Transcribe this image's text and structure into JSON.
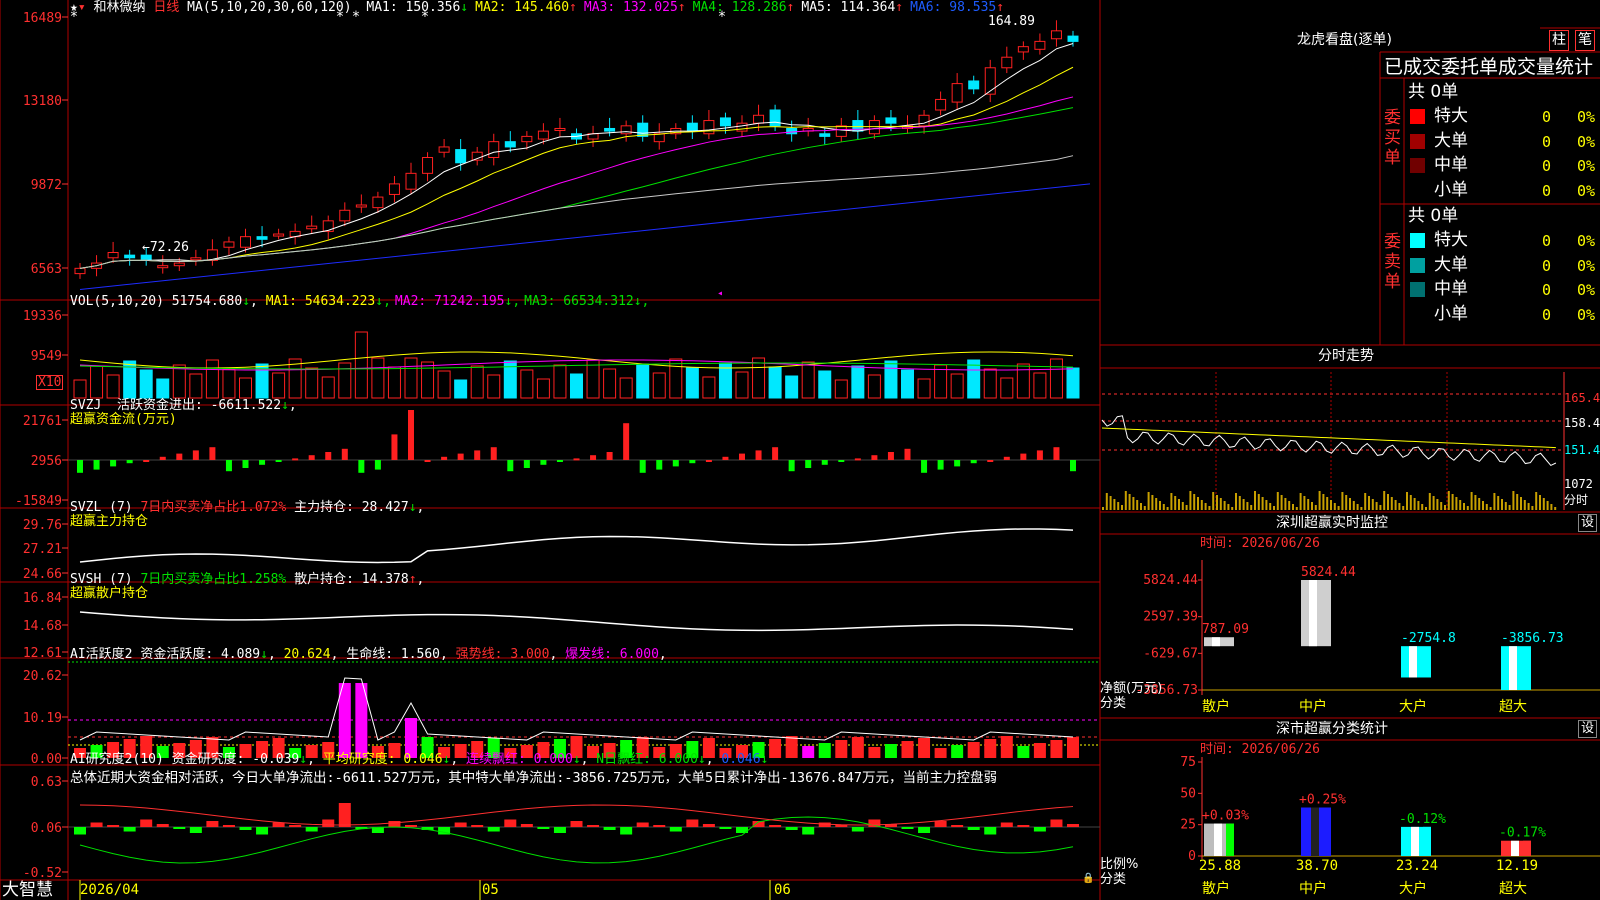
{
  "colors": {
    "up": "#ff2020",
    "down": "#00e8ff",
    "grid": "#b00000",
    "axis": "#ff3030",
    "yellow": "#ffff00",
    "magenta": "#ff00ff",
    "green": "#00e000",
    "blue": "#1e2cff",
    "cyan_dark": "#008080"
  },
  "main": {
    "stock_name": "和林微纳",
    "period": "日线",
    "ma_label": "MA(5,10,20,30,60,120)",
    "ma_values": [
      {
        "label": "MA1:",
        "value": "150.356",
        "arrow": "↓",
        "color": "#ffffff"
      },
      {
        "label": "MA2:",
        "value": "145.460",
        "arrow": "↑",
        "color": "#ffff00"
      },
      {
        "label": "MA3:",
        "value": "132.025",
        "arrow": "↑",
        "color": "#ff00ff"
      },
      {
        "label": "MA4:",
        "value": "128.286",
        "arrow": "↑",
        "color": "#00e000"
      },
      {
        "label": "MA5:",
        "value": "114.364",
        "arrow": "↑",
        "color": "#ffffff"
      },
      {
        "label": "MA6:",
        "value": "98.535",
        "arrow": "↑",
        "color": "#1e5cff"
      }
    ],
    "y_ticks": [
      "16489",
      "13180",
      "9872",
      "6563"
    ],
    "high_label": "164.89",
    "low_label": "72.26"
  },
  "vol": {
    "title": "VOL(5,10,20)",
    "value": "51754.680",
    "arrow": "↓",
    "ma": [
      {
        "label": "MA1:",
        "value": "54634.223",
        "arrow": "↓",
        "color": "#ffff00"
      },
      {
        "label": "MA2:",
        "value": "71242.195",
        "arrow": "↓",
        "color": "#ff00ff"
      },
      {
        "label": "MA3:",
        "value": "66534.312",
        "arrow": "↓",
        "color": "#00e000"
      }
    ],
    "y_ticks": [
      "19336",
      "9549"
    ],
    "unit": "X10"
  },
  "svzj": {
    "name": "SVZJ",
    "label": "活跃资金进出:",
    "value": "-6611.522",
    "arrow": "↓",
    "sub": "超赢资金流(万元)",
    "y_ticks": [
      "21761",
      "2956",
      "-15849"
    ]
  },
  "svzl": {
    "name": "SVZL (7)",
    "label1": "7日内买卖净占比1.072%",
    "label2": "主力持仓:",
    "value": "28.427",
    "arrow": "↓",
    "sub": "超赢主力持仓",
    "y_ticks": [
      "29.76",
      "27.21",
      "24.66"
    ]
  },
  "svsh": {
    "name": "SVSH (7)",
    "label1": "7日内买卖净占比1.258%",
    "label2": "散户持仓:",
    "value": "14.378",
    "arrow": "↑",
    "sub": "超赢散户持仓",
    "y_ticks": [
      "16.84",
      "14.68",
      "12.61"
    ]
  },
  "ai1": {
    "name": "AI活跃度2",
    "label": "资金活跃度:",
    "value": "4.089",
    "arrow": "↓",
    "value2": "20.624",
    "label3": "生命线:",
    "value3": "1.560",
    "label4": "强势线:",
    "value4": "3.000",
    "label5": "爆发线:",
    "value5": "6.000",
    "y_ticks": [
      "20.62",
      "10.19",
      "0.00"
    ]
  },
  "ai2": {
    "name": "AI研究度2(10)",
    "label": "资金研究度:",
    "value": "-0.039",
    "label2": "平均研究度:",
    "value2": "0.046",
    "label3": "连续飘红:",
    "value3": "0.000",
    "label4": "N日飘红:",
    "value4": "6.000",
    "value5": "0.046",
    "summary": "总体近期大资金相对活跃，今日大单净流出:-6611.527万元，其中特大单净流出:-3856.725万元，大单5日累计净出-13676.847万元，当前主力控盘弱",
    "y_ticks": [
      "0.63",
      "0.06",
      "-0.52"
    ]
  },
  "bottom": {
    "brand": "大智慧",
    "dates": [
      "2026/04",
      "05",
      "06"
    ]
  },
  "dragon": {
    "title": "龙虎看盘(逐单)",
    "btn1": "柱",
    "btn2": "笔",
    "heading": "已成交委托单成交量统计",
    "buy_label": "委买单",
    "sell_label": "委卖单",
    "buy_total": "共 0单",
    "sell_total": "共 0单",
    "buy_rows": [
      {
        "name": "特大",
        "count": "0",
        "pct": "0%",
        "color": "#ff0000"
      },
      {
        "name": "大单",
        "count": "0",
        "pct": "0%",
        "color": "#a00000"
      },
      {
        "name": "中单",
        "count": "0",
        "pct": "0%",
        "color": "#700000"
      },
      {
        "name": "小单",
        "count": "0",
        "pct": "0%",
        "color": ""
      }
    ],
    "sell_rows": [
      {
        "name": "特大",
        "count": "0",
        "pct": "0%",
        "color": "#00ffff"
      },
      {
        "name": "大单",
        "count": "0",
        "pct": "0%",
        "color": "#00a0a0"
      },
      {
        "name": "中单",
        "count": "0",
        "pct": "0%",
        "color": "#007070"
      },
      {
        "name": "小单",
        "count": "0",
        "pct": "0%",
        "color": ""
      }
    ]
  },
  "intraday": {
    "title": "分时走势",
    "y_ticks": [
      "165.4",
      "158.4",
      "151.4"
    ],
    "vol_tick": "1072",
    "unit": "分时"
  },
  "monitor": {
    "title": "深圳超赢实时监控",
    "set": "设",
    "time_label": "时间:",
    "date": "2026/06/26",
    "y_ticks": [
      "5824.44",
      "2597.39",
      "-629.67",
      "-3856.73"
    ],
    "axis_label1": "净额(万元)",
    "axis_label2": "分类",
    "bars": [
      {
        "label": "散户",
        "value": 787.09,
        "text": "787.09"
      },
      {
        "label": "中户",
        "value": 5824.44,
        "text": "5824.44"
      },
      {
        "label": "大户",
        "value": -2754.8,
        "text": "-2754.8"
      },
      {
        "label": "超大",
        "value": -3856.73,
        "text": "-3856.73"
      }
    ]
  },
  "classify": {
    "title": "深市超赢分类统计",
    "set": "设",
    "time_label": "时间:",
    "date": "2026/06/26",
    "y_ticks": [
      "75",
      "50",
      "25",
      "0"
    ],
    "axis_label1": "比例%",
    "axis_label2": "分类",
    "bars": [
      {
        "label": "散户",
        "value": 25.88,
        "text": "25.88",
        "change": "+0.03%"
      },
      {
        "label": "中户",
        "value": 38.7,
        "text": "38.70",
        "change": "+0.25%"
      },
      {
        "label": "大户",
        "value": 23.24,
        "text": "23.24",
        "change": "-0.12%"
      },
      {
        "label": "超大",
        "value": 12.19,
        "text": "12.19",
        "change": "-0.17%"
      }
    ]
  }
}
